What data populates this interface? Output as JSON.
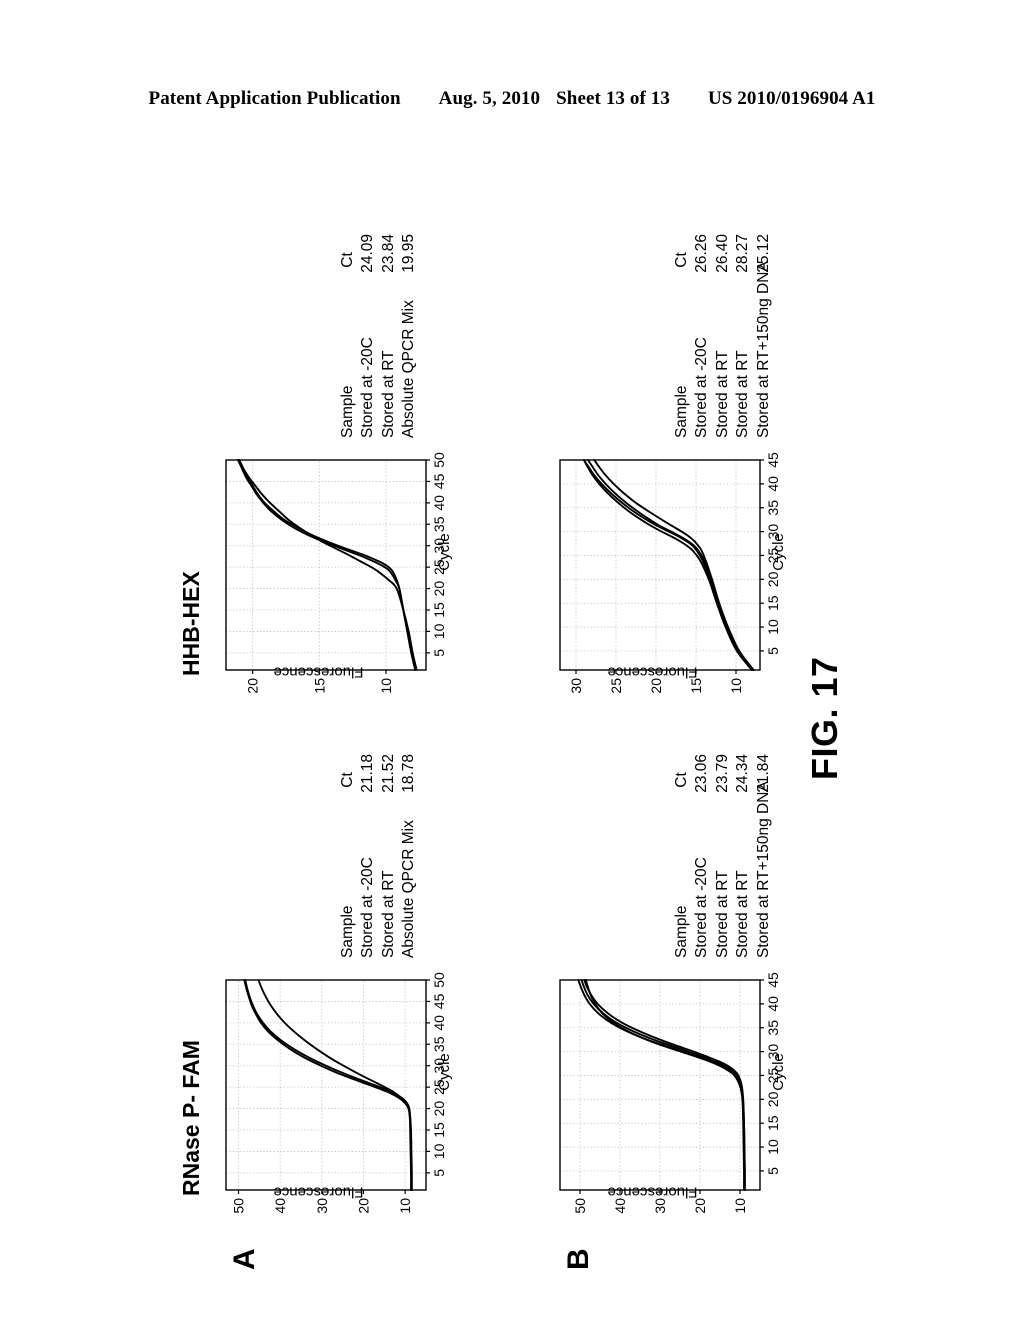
{
  "header": {
    "publication": "Patent Application Publication",
    "date": "Aug. 5, 2010",
    "sheet": "Sheet 13 of 13",
    "number": "US 2010/0196904 A1"
  },
  "figure": {
    "label": "FIG. 17",
    "column_titles": {
      "left": "RNase P- FAM",
      "right": "HHB-HEX"
    },
    "panel_letters": {
      "a": "A",
      "b": "B"
    }
  },
  "chart_data": [
    {
      "id": "a-fam",
      "type": "line",
      "panel": "A",
      "title": "RNase P- FAM",
      "xlabel": "Cycle",
      "ylabel": "Fluorescence",
      "xlim": [
        1,
        50
      ],
      "ylim": [
        5,
        53
      ],
      "xticks": [
        5,
        10,
        15,
        20,
        25,
        30,
        35,
        40,
        45,
        50
      ],
      "yticks": [
        10,
        20,
        30,
        40,
        50
      ],
      "grid": true,
      "legend_headers": {
        "sample": "Sample",
        "ct": "Ct"
      },
      "legend": [
        {
          "sample": "Stored at -20C",
          "ct": "21.18"
        },
        {
          "sample": "Stored at RT",
          "ct": "21.52"
        },
        {
          "sample": "Absolute QPCR Mix",
          "ct": "18.78"
        }
      ],
      "series": [
        {
          "name": "Stored at -20C",
          "ct": 21.18,
          "x": [
            1,
            5,
            10,
            15,
            18,
            20,
            21,
            22,
            23,
            24,
            25,
            26,
            28,
            30,
            32,
            34,
            36,
            38,
            40,
            42,
            44,
            46,
            48,
            50
          ],
          "y": [
            8.6,
            8.6,
            8.7,
            8.8,
            8.9,
            9.2,
            9.8,
            10.8,
            12.4,
            14.5,
            17.2,
            20.0,
            25.5,
            30.2,
            34.4,
            37.8,
            40.6,
            42.9,
            44.6,
            45.8,
            46.8,
            47.5,
            48.1,
            48.6
          ]
        },
        {
          "name": "Stored at RT",
          "ct": 21.52,
          "x": [
            1,
            5,
            10,
            15,
            18,
            20,
            21,
            22,
            23,
            24,
            25,
            26,
            28,
            30,
            32,
            34,
            36,
            38,
            40,
            42,
            44,
            46,
            48,
            50
          ],
          "y": [
            8.5,
            8.5,
            8.6,
            8.7,
            8.8,
            9.0,
            9.4,
            10.2,
            11.6,
            13.5,
            16.0,
            18.8,
            24.2,
            29.0,
            33.3,
            36.9,
            39.9,
            42.3,
            44.1,
            45.5,
            46.5,
            47.3,
            47.9,
            48.4
          ]
        },
        {
          "name": "Absolute QPCR Mix",
          "ct": 18.78,
          "x": [
            1,
            5,
            10,
            15,
            18,
            20,
            21,
            22,
            23,
            24,
            25,
            26,
            28,
            30,
            32,
            34,
            36,
            38,
            40,
            42,
            44,
            46,
            48,
            50
          ],
          "y": [
            8.4,
            8.4,
            8.5,
            8.6,
            8.8,
            9.1,
            9.6,
            10.4,
            11.6,
            13.0,
            14.9,
            16.9,
            21.0,
            24.8,
            28.3,
            31.4,
            34.2,
            36.7,
            38.9,
            40.7,
            42.2,
            43.4,
            44.4,
            45.2
          ]
        }
      ]
    },
    {
      "id": "a-hex",
      "type": "line",
      "panel": "A",
      "title": "HHB-HEX",
      "xlabel": "Cycle",
      "ylabel": "Fluorescence",
      "xlim": [
        1,
        50
      ],
      "ylim": [
        7,
        22
      ],
      "xticks": [
        5,
        10,
        15,
        20,
        25,
        30,
        35,
        40,
        45,
        50
      ],
      "yticks": [
        10,
        15,
        20
      ],
      "grid": true,
      "legend_headers": {
        "sample": "Sample",
        "ct": "Ct"
      },
      "legend": [
        {
          "sample": "Stored at -20C",
          "ct": "24.09"
        },
        {
          "sample": "Stored at RT",
          "ct": "23.84"
        },
        {
          "sample": "Absolute QPCR Mix",
          "ct": "19.95"
        }
      ],
      "series": [
        {
          "name": "Stored at -20C",
          "ct": 24.09,
          "x": [
            1,
            5,
            10,
            15,
            20,
            22,
            24,
            25,
            26,
            27,
            28,
            30,
            32,
            34,
            36,
            38,
            40,
            42,
            44,
            46,
            48,
            50
          ],
          "y": [
            7.8,
            8.1,
            8.4,
            8.7,
            9.0,
            9.2,
            9.5,
            9.8,
            10.3,
            11.0,
            11.8,
            13.6,
            15.2,
            16.5,
            17.6,
            18.4,
            19.1,
            19.6,
            20.0,
            20.4,
            20.7,
            21.0
          ]
        },
        {
          "name": "Stored at RT",
          "ct": 23.84,
          "x": [
            1,
            5,
            10,
            15,
            20,
            22,
            24,
            25,
            26,
            27,
            28,
            30,
            32,
            34,
            36,
            38,
            40,
            42,
            44,
            46,
            48,
            50
          ],
          "y": [
            7.8,
            8.1,
            8.4,
            8.7,
            9.0,
            9.3,
            9.7,
            10.1,
            10.7,
            11.4,
            12.2,
            13.9,
            15.5,
            16.8,
            17.8,
            18.6,
            19.2,
            19.7,
            20.1,
            20.5,
            20.8,
            21.1
          ]
        },
        {
          "name": "Absolute QPCR Mix",
          "ct": 19.95,
          "x": [
            1,
            5,
            10,
            15,
            20,
            22,
            24,
            25,
            26,
            27,
            28,
            30,
            32,
            34,
            36,
            38,
            40,
            42,
            44,
            46,
            48,
            50
          ],
          "y": [
            7.7,
            8.0,
            8.3,
            8.7,
            9.2,
            9.8,
            10.6,
            11.1,
            11.7,
            12.3,
            12.9,
            14.2,
            15.4,
            16.4,
            17.3,
            18.0,
            18.7,
            19.3,
            19.8,
            20.3,
            20.7,
            21.1
          ]
        }
      ]
    },
    {
      "id": "b-fam",
      "type": "line",
      "panel": "B",
      "title": "RNase P- FAM",
      "xlabel": "Cycle",
      "ylabel": "Fluorescence",
      "xlim": [
        1,
        45
      ],
      "ylim": [
        5,
        55
      ],
      "xticks": [
        5,
        10,
        15,
        20,
        25,
        30,
        35,
        40,
        45
      ],
      "yticks": [
        10,
        20,
        30,
        40,
        50
      ],
      "grid": true,
      "legend_headers": {
        "sample": "Sample",
        "ct": "Ct"
      },
      "legend": [
        {
          "sample": "Stored at -20C",
          "ct": "23.06"
        },
        {
          "sample": "Stored at RT",
          "ct": "23.79"
        },
        {
          "sample": "Stored at RT",
          "ct": "24.34"
        },
        {
          "sample": "Stored at RT+150ng DNA",
          "ct": "21.84"
        }
      ],
      "series": [
        {
          "name": "Stored at -20C",
          "ct": 23.06,
          "x": [
            1,
            5,
            10,
            15,
            20,
            23,
            25,
            26,
            27,
            28,
            29,
            30,
            32,
            34,
            36,
            38,
            40,
            42,
            44,
            45
          ],
          "y": [
            9.0,
            9.0,
            9.1,
            9.2,
            9.4,
            10.0,
            11.2,
            12.6,
            14.6,
            17.4,
            20.8,
            24.4,
            31.6,
            37.6,
            42.2,
            45.4,
            47.6,
            49.0,
            50.0,
            50.4
          ]
        },
        {
          "name": "Stored at RT",
          "ct": 23.79,
          "x": [
            1,
            5,
            10,
            15,
            20,
            23,
            25,
            26,
            27,
            28,
            29,
            30,
            32,
            34,
            36,
            38,
            40,
            42,
            44,
            45
          ],
          "y": [
            8.9,
            8.9,
            9.0,
            9.1,
            9.3,
            9.8,
            10.8,
            12.0,
            13.8,
            16.4,
            19.6,
            23.0,
            30.0,
            36.0,
            40.8,
            44.2,
            46.6,
            48.2,
            49.2,
            49.6
          ]
        },
        {
          "name": "Stored at RT",
          "ct": 24.34,
          "x": [
            1,
            5,
            10,
            15,
            20,
            23,
            25,
            26,
            27,
            28,
            29,
            30,
            32,
            34,
            36,
            38,
            40,
            42,
            44,
            45
          ],
          "y": [
            8.8,
            8.8,
            8.9,
            9.0,
            9.2,
            9.6,
            10.4,
            11.4,
            13.0,
            15.4,
            18.4,
            21.6,
            28.4,
            34.4,
            39.4,
            43.0,
            45.6,
            47.3,
            48.5,
            48.9
          ]
        },
        {
          "name": "Stored at RT+150ng DNA",
          "ct": 21.84,
          "x": [
            1,
            5,
            10,
            15,
            20,
            23,
            25,
            26,
            27,
            28,
            29,
            30,
            32,
            34,
            36,
            38,
            40,
            42,
            44,
            45
          ],
          "y": [
            8.8,
            8.8,
            8.9,
            9.0,
            9.3,
            10.1,
            11.4,
            12.9,
            15.0,
            17.8,
            21.2,
            24.8,
            31.8,
            37.4,
            41.6,
            44.4,
            46.2,
            47.4,
            48.2,
            48.5
          ]
        }
      ]
    },
    {
      "id": "b-hex",
      "type": "line",
      "panel": "B",
      "title": "HHB-HEX",
      "xlabel": "Cycle",
      "ylabel": "Fluorescence",
      "xlim": [
        1,
        45
      ],
      "ylim": [
        7,
        32
      ],
      "xticks": [
        5,
        10,
        15,
        20,
        25,
        30,
        35,
        40,
        45
      ],
      "yticks": [
        10,
        15,
        20,
        25,
        30
      ],
      "grid": true,
      "legend_headers": {
        "sample": "Sample",
        "ct": "Ct"
      },
      "legend": [
        {
          "sample": "Stored at -20C",
          "ct": "26.26"
        },
        {
          "sample": "Stored at RT",
          "ct": "26.40"
        },
        {
          "sample": "Stored at RT",
          "ct": "28.27"
        },
        {
          "sample": "Stored at RT+150ng DNA",
          "ct": "25.12"
        }
      ],
      "series": [
        {
          "name": "Stored at -20C",
          "ct": 26.26,
          "x": [
            1,
            5,
            10,
            15,
            20,
            24,
            26,
            27,
            28,
            29,
            30,
            31,
            32,
            34,
            36,
            38,
            40,
            42,
            44,
            45
          ],
          "y": [
            8.0,
            9.8,
            11.2,
            12.3,
            13.2,
            14.2,
            14.9,
            15.4,
            16.2,
            17.2,
            18.4,
            19.6,
            20.7,
            22.6,
            24.2,
            25.6,
            26.8,
            27.8,
            28.6,
            29.0
          ]
        },
        {
          "name": "Stored at RT",
          "ct": 26.4,
          "x": [
            1,
            5,
            10,
            15,
            20,
            24,
            26,
            27,
            28,
            29,
            30,
            31,
            32,
            34,
            36,
            38,
            40,
            42,
            44,
            45
          ],
          "y": [
            7.9,
            9.7,
            11.1,
            12.2,
            13.1,
            14.0,
            14.7,
            15.2,
            16.0,
            17.0,
            18.1,
            19.3,
            20.3,
            22.1,
            23.7,
            25.1,
            26.3,
            27.3,
            28.1,
            28.5
          ]
        },
        {
          "name": "Stored at RT",
          "ct": 28.27,
          "x": [
            1,
            5,
            10,
            15,
            20,
            24,
            26,
            27,
            28,
            29,
            30,
            31,
            32,
            34,
            36,
            38,
            40,
            42,
            44,
            45
          ],
          "y": [
            7.8,
            9.6,
            11.0,
            12.1,
            13.0,
            13.8,
            14.3,
            14.7,
            15.2,
            15.9,
            16.8,
            17.8,
            18.8,
            20.7,
            22.5,
            24.0,
            25.3,
            26.4,
            27.3,
            27.7
          ]
        },
        {
          "name": "Stored at RT+150ng DNA",
          "ct": 25.12,
          "x": [
            1,
            5,
            10,
            15,
            20,
            24,
            26,
            27,
            28,
            29,
            30,
            31,
            32,
            34,
            36,
            38,
            40,
            42,
            44,
            45
          ],
          "y": [
            8.0,
            9.9,
            11.3,
            12.4,
            13.4,
            14.5,
            15.4,
            16.1,
            17.0,
            18.1,
            19.3,
            20.4,
            21.4,
            23.2,
            24.7,
            26.0,
            27.1,
            28.0,
            28.7,
            29.0
          ]
        }
      ]
    }
  ]
}
